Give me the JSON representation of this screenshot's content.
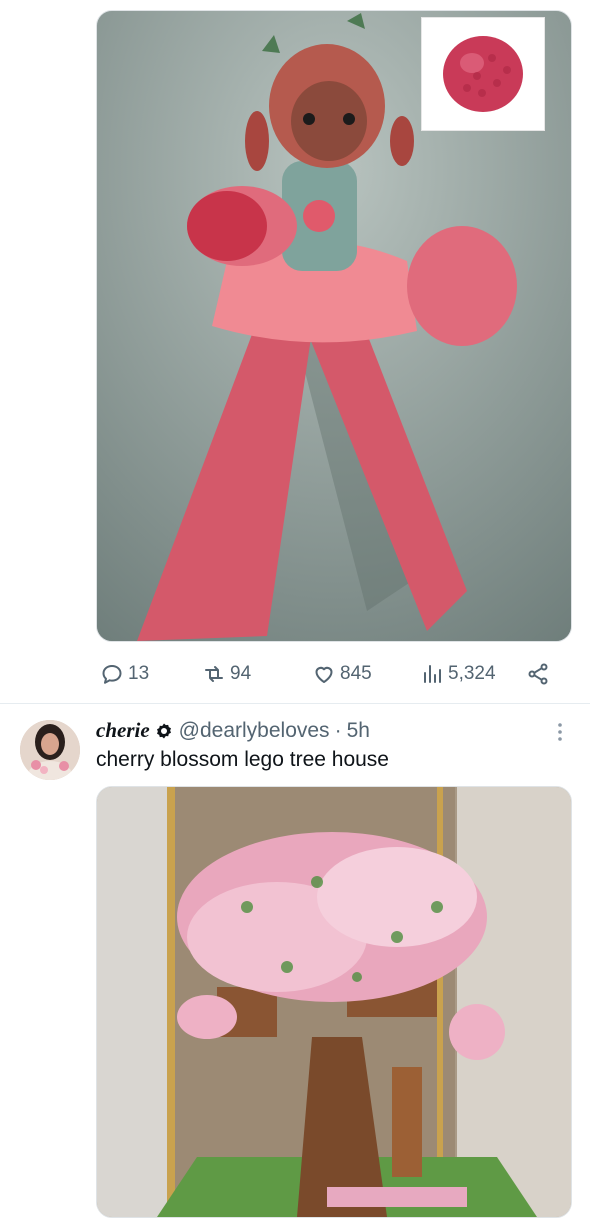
{
  "post1": {
    "media_description": "illustration",
    "actions": {
      "replies": "13",
      "reposts": "94",
      "likes": "845",
      "views": "5,324"
    }
  },
  "post2": {
    "display_name": "cherie",
    "handle": "@dearlybeloves",
    "separator": "·",
    "time": "5h",
    "text": "cherry blossom lego tree house"
  },
  "colors": {
    "text_primary": "#0f1419",
    "text_secondary": "#536471",
    "divider": "#e6ecf0"
  }
}
